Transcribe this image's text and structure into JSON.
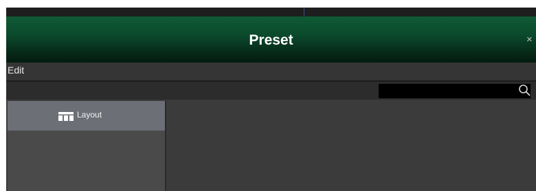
{
  "window": {
    "title": "Preset",
    "close_label": "×"
  },
  "menu": {
    "items": [
      {
        "label": "Edit"
      }
    ]
  },
  "search": {
    "value": "",
    "placeholder": "",
    "icon": "search-icon"
  },
  "tree": {
    "items": [
      {
        "label": "Layout",
        "icon": "layout-icon",
        "selected": true
      }
    ]
  },
  "colors": {
    "title_gradient_top": "#0f5b36",
    "title_gradient_bottom": "#041b10",
    "panel_bg": "#3b3b3b",
    "selected_item_bg": "#6c7076"
  }
}
